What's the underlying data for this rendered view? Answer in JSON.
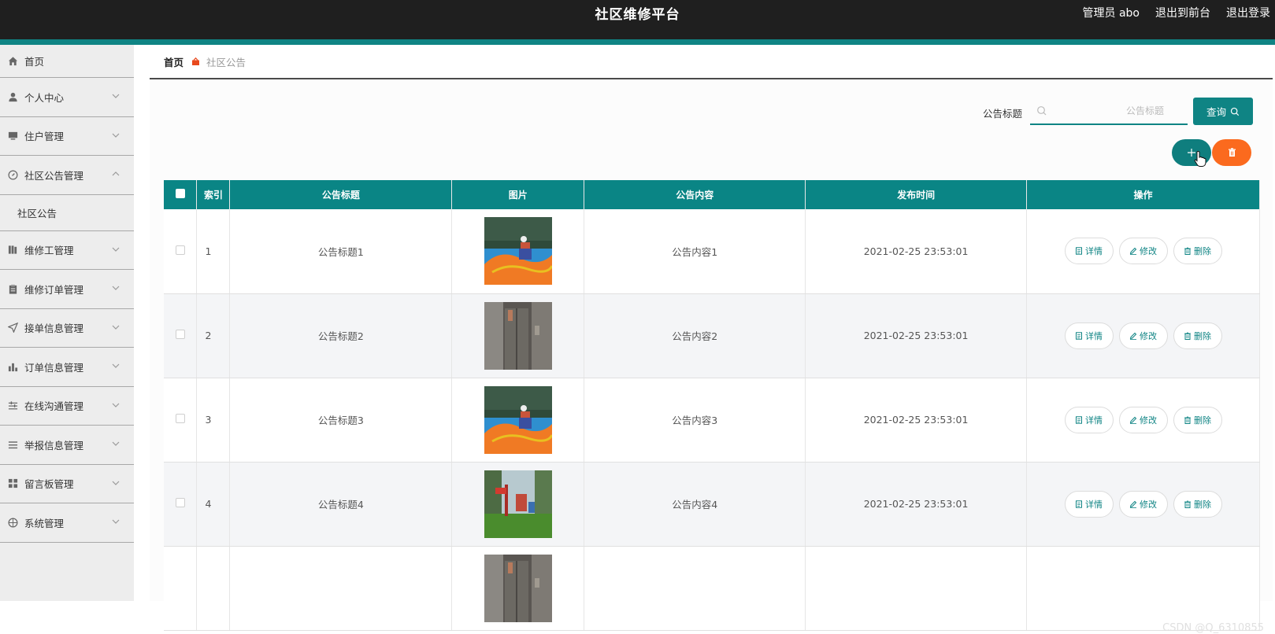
{
  "header": {
    "title": "社区维修平台",
    "admin_label": "管理员 abo",
    "front_label": "退出到前台",
    "logout_label": "退出登录"
  },
  "sidebar": {
    "items": [
      {
        "label": "首页",
        "icon": "home-icon"
      },
      {
        "label": "个人中心",
        "icon": "user-icon"
      },
      {
        "label": "住户管理",
        "icon": "monitor-icon"
      },
      {
        "label": "社区公告管理",
        "icon": "compass-icon",
        "expanded": true
      },
      {
        "label": "维修工管理",
        "icon": "book-icon"
      },
      {
        "label": "维修订单管理",
        "icon": "clipboard-icon"
      },
      {
        "label": "接单信息管理",
        "icon": "send-icon"
      },
      {
        "label": "订单信息管理",
        "icon": "bar-chart-icon"
      },
      {
        "label": "在线沟通管理",
        "icon": "sliders-icon"
      },
      {
        "label": "举报信息管理",
        "icon": "list-icon"
      },
      {
        "label": "留言板管理",
        "icon": "grid-icon"
      },
      {
        "label": "系统管理",
        "icon": "globe-icon"
      }
    ],
    "sub_item": "社区公告"
  },
  "breadcrumb": {
    "home": "首页",
    "current": "社区公告"
  },
  "search": {
    "label": "公告标题",
    "placeholder": "公告标题",
    "value": "",
    "button": "查询"
  },
  "table": {
    "headers": [
      "索引",
      "公告标题",
      "图片",
      "公告内容",
      "发布时间",
      "操作"
    ],
    "rows": [
      {
        "index": "1",
        "title": "公告标题1",
        "image": "playground",
        "content": "公告内容1",
        "time": "2021-02-25 23:53:01"
      },
      {
        "index": "2",
        "title": "公告标题2",
        "image": "elevator",
        "content": "公告内容2",
        "time": "2021-02-25 23:53:01"
      },
      {
        "index": "3",
        "title": "公告标题3",
        "image": "playground",
        "content": "公告内容3",
        "time": "2021-02-25 23:53:01"
      },
      {
        "index": "4",
        "title": "公告标题4",
        "image": "park",
        "content": "公告内容4",
        "time": "2021-02-25 23:53:01"
      }
    ],
    "actions": {
      "detail": "详情",
      "edit": "修改",
      "delete": "删除"
    }
  },
  "watermark": "CSDN @Q_6310855",
  "colors": {
    "primary": "#0f8484",
    "danger": "#fb6a1e",
    "topbar": "#1f1f1f"
  }
}
